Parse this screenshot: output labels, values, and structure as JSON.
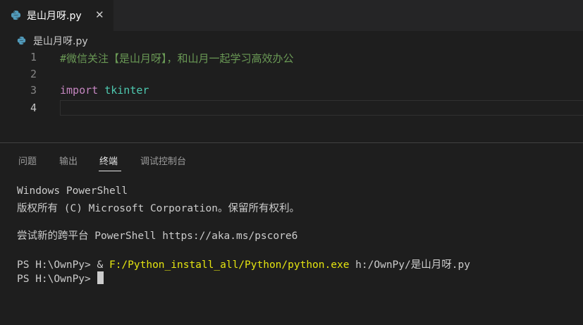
{
  "tab": {
    "label": "是山月呀.py",
    "close_glyph": "✕",
    "icon": "python-icon"
  },
  "breadcrumb": {
    "label": "是山月呀.py",
    "icon": "python-icon"
  },
  "editor": {
    "lines": [
      {
        "number": "1",
        "comment": "#微信关注【是山月呀】，和山月一起学习高效办公"
      },
      {
        "number": "2"
      },
      {
        "number": "3",
        "keyword": "import",
        "module": "tkinter"
      },
      {
        "number": "4"
      }
    ]
  },
  "panel": {
    "tabs": [
      "问题",
      "输出",
      "终端",
      "调试控制台"
    ],
    "active_tab": "终端"
  },
  "terminal": {
    "line1": "Windows PowerShell",
    "line2": "版权所有 (C) Microsoft Corporation。保留所有权利。",
    "line3": "尝试新的跨平台 PowerShell https://aka.ms/pscore6",
    "prompt1": "PS H:\\OwnPy> ",
    "amp": "& ",
    "exe": "F:/Python_install_all/Python/python.exe",
    "arg": " h:/OwnPy/是山月呀.py",
    "prompt2": "PS H:\\OwnPy> "
  },
  "colors": {
    "background": "#1e1e1e",
    "comment": "#6a9955",
    "keyword": "#c586c0",
    "module": "#4ec9b0",
    "exe_path": "#e5e510"
  }
}
